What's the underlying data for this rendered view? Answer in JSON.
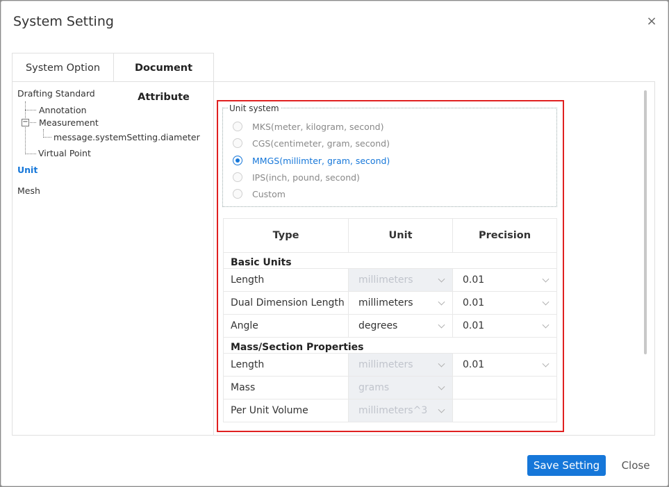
{
  "dialog": {
    "title": "System Setting",
    "close_glyph": "×"
  },
  "tabs": [
    {
      "label": "System Option",
      "active": false
    },
    {
      "label": "Document Attribute",
      "active": true
    }
  ],
  "tree": {
    "drafting_standard": "Drafting Standard",
    "annotation": "Annotation",
    "measurement": "Measurement",
    "measurement_expander": "−",
    "diameter": "message.systemSetting.diameter",
    "virtual_point": "Virtual Point",
    "unit": "Unit",
    "mesh": "Mesh"
  },
  "unit_system": {
    "legend": "Unit system",
    "options": [
      {
        "label": "MKS(meter, kilogram, second)",
        "checked": false
      },
      {
        "label": "CGS(centimeter, gram, second)",
        "checked": false
      },
      {
        "label": "MMGS(millimter, gram, second)",
        "checked": true
      },
      {
        "label": "IPS(inch, pound, second)",
        "checked": false
      },
      {
        "label": "Custom",
        "checked": false
      }
    ]
  },
  "table": {
    "headers": {
      "type": "Type",
      "unit": "Unit",
      "precision": "Precision"
    },
    "basic_units": {
      "label": "Basic Units",
      "rows": [
        {
          "type": "Length",
          "unit": "millimeters",
          "unit_disabled": true,
          "precision": "0.01"
        },
        {
          "type": "Dual Dimension Length",
          "unit": "millimeters",
          "unit_disabled": false,
          "precision": "0.01"
        },
        {
          "type": "Angle",
          "unit": "degrees",
          "unit_disabled": false,
          "precision": "0.01"
        }
      ]
    },
    "mass_section": {
      "label": "Mass/Section Properties",
      "rows": [
        {
          "type": "Length",
          "unit": "millimeters",
          "unit_disabled": true,
          "precision": "0.01"
        },
        {
          "type": "Mass",
          "unit": "grams",
          "unit_disabled": true,
          "precision": ""
        },
        {
          "type": "Per Unit Volume",
          "unit": "millimeters^3",
          "unit_disabled": true,
          "precision": ""
        }
      ]
    }
  },
  "footer": {
    "save_label": "Save Setting",
    "close_label": "Close"
  },
  "colors": {
    "accent": "#1677d9",
    "highlight_border": "#e02020"
  }
}
